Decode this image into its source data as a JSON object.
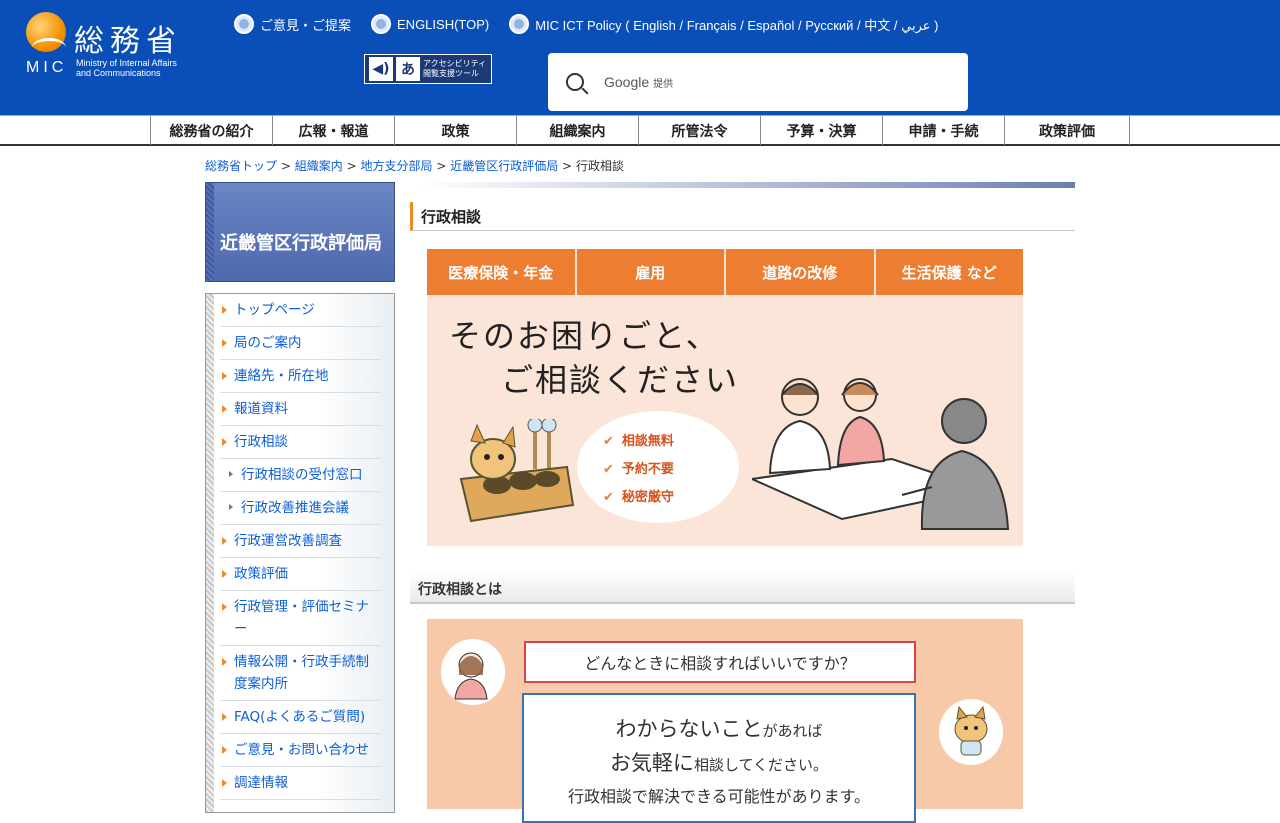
{
  "header": {
    "logo_jp": "総務省",
    "logo_mic": "MIC",
    "logo_en_line1": "Ministry of Internal Affairs",
    "logo_en_line2": "and Communications",
    "links": [
      {
        "label": "ご意見・ご提案"
      },
      {
        "label": "ENGLISH(TOP)"
      },
      {
        "label": "MIC ICT Policy ( English / Français / Español / Русский / 中文 / عربي )"
      }
    ],
    "accessibility_line1": "アクセシビリティ",
    "accessibility_line2": "閲覧支援ツール",
    "accessibility_glyph": "あ",
    "search_brand": "Google",
    "search_provided": "提供"
  },
  "gnav": [
    "総務省の紹介",
    "広報・報道",
    "政策",
    "組織案内",
    "所管法令",
    "予算・決算",
    "申請・手続",
    "政策評価"
  ],
  "breadcrumb": {
    "items": [
      "総務省トップ",
      "組織案内",
      "地方支分部局",
      "近畿管区行政評価局"
    ],
    "separator": ">",
    "current": "行政相談"
  },
  "sidebar": {
    "title": "近畿管区行政評価局",
    "items": [
      {
        "label": "トップページ",
        "sub": false
      },
      {
        "label": "局のご案内",
        "sub": false
      },
      {
        "label": "連絡先・所在地",
        "sub": false
      },
      {
        "label": "報道資料",
        "sub": false
      },
      {
        "label": "行政相談",
        "sub": false
      },
      {
        "label": "行政相談の受付窓口",
        "sub": true
      },
      {
        "label": "行政改善推進会議",
        "sub": true
      },
      {
        "label": "行政運営改善調査",
        "sub": false
      },
      {
        "label": "政策評価",
        "sub": false
      },
      {
        "label": "行政管理・評価セミナー",
        "sub": false
      },
      {
        "label": "情報公開・行政手続制度案内所",
        "sub": false
      },
      {
        "label": "FAQ(よくあるご質問)",
        "sub": false
      },
      {
        "label": "ご意見・お問い合わせ",
        "sub": false
      },
      {
        "label": "調達情報",
        "sub": false
      }
    ]
  },
  "main": {
    "title": "行政相談",
    "banner": {
      "tabs": [
        "医療保険・年金",
        "雇用",
        "道路の改修",
        "生活保護 など"
      ],
      "headline1": "そのお困りごと、",
      "headline2": "ご相談ください",
      "checks": [
        "相談無料",
        "予約不要",
        "秘密厳守"
      ]
    },
    "section_title": "行政相談とは",
    "banner2": {
      "question": "どんなときに相談すればいいですか？",
      "answer_big1": "わからないこと",
      "answer_small1": "があれば",
      "answer_big2": "お気軽に",
      "answer_small2": "相談してください。",
      "answer_line3": "行政相談で解決できる可能性があります。"
    }
  },
  "colors": {
    "header_blue": "#0a4fb8",
    "accent_orange": "#ed7d31",
    "sidebar_title_blue": "#4e68ad"
  }
}
